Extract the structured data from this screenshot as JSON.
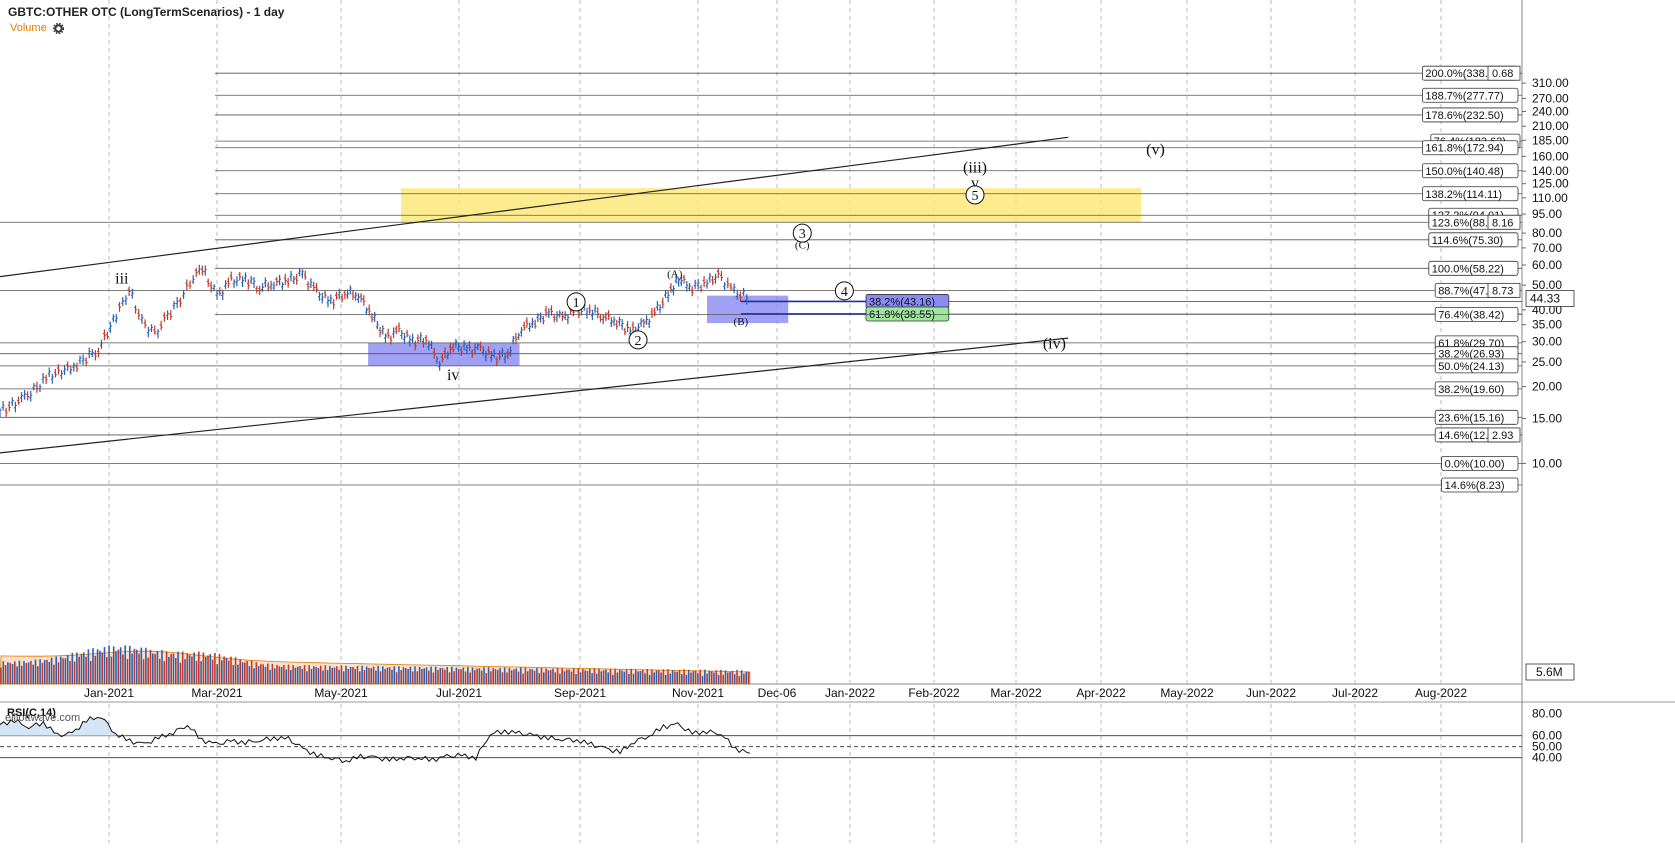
{
  "header": {
    "title": "GBTC:OTHER OTC (LongTermScenarios) - 1 day",
    "volume_label": "Volume",
    "watermark": "elliottwave.com"
  },
  "colors": {
    "up_bar": "#2962b5",
    "down_bar": "#c0392b",
    "yellow_zone": "#fde97a",
    "blue_zone": "#8080f0",
    "volume_ma_fill": "#f6c9a6",
    "rsi_fill": "#cfe3f5",
    "grid": "#bbbbbb"
  },
  "chart_data": [
    {
      "type": "line",
      "title": "GBTC:OTHER OTC (LongTermScenarios) - 1 day",
      "y_scale": "log",
      "ylim": [
        8,
        330
      ],
      "x_ticks": [
        "Jan-2021",
        "Mar-2021",
        "May-2021",
        "Jul-2021",
        "Sep-2021",
        "Nov-2021",
        "Dec-06",
        "Jan-2022",
        "Feb-2022",
        "Mar-2022",
        "Apr-2022",
        "May-2022",
        "Jun-2022",
        "Jul-2022",
        "Aug-2022"
      ],
      "y_ticks": [
        310.0,
        270.0,
        240.0,
        210.0,
        185.0,
        160.0,
        140.0,
        125.0,
        110.0,
        95.0,
        80.0,
        70.0,
        60.0,
        50.0,
        40.0,
        35.0,
        30.0,
        25.0,
        20.0,
        15.0,
        10.0
      ],
      "last_price": "44.33",
      "last_price_value": 44.33,
      "volume_last": "5.6M",
      "price_path": [
        [
          "2020-12-01",
          16
        ],
        [
          "2020-12-08",
          18
        ],
        [
          "2020-12-15",
          22
        ],
        [
          "2020-12-22",
          24
        ],
        [
          "2020-12-29",
          28
        ],
        [
          "2021-01-05",
          38
        ],
        [
          "2021-01-12",
          48
        ],
        [
          "2021-01-19",
          36
        ],
        [
          "2021-01-26",
          32
        ],
        [
          "2021-02-02",
          38
        ],
        [
          "2021-02-09",
          44
        ],
        [
          "2021-02-16",
          54
        ],
        [
          "2021-02-21",
          58
        ],
        [
          "2021-03-01",
          45
        ],
        [
          "2021-03-08",
          52
        ],
        [
          "2021-03-15",
          53
        ],
        [
          "2021-03-22",
          49
        ],
        [
          "2021-03-29",
          51
        ],
        [
          "2021-04-05",
          52
        ],
        [
          "2021-04-12",
          55
        ],
        [
          "2021-04-19",
          47
        ],
        [
          "2021-04-26",
          43
        ],
        [
          "2021-05-03",
          47
        ],
        [
          "2021-05-10",
          46
        ],
        [
          "2021-05-17",
          38
        ],
        [
          "2021-05-24",
          31
        ],
        [
          "2021-05-31",
          33
        ],
        [
          "2021-06-07",
          30
        ],
        [
          "2021-06-14",
          31
        ],
        [
          "2021-06-21",
          25
        ],
        [
          "2021-06-28",
          29
        ],
        [
          "2021-07-05",
          28
        ],
        [
          "2021-07-12",
          28
        ],
        [
          "2021-07-19",
          26
        ],
        [
          "2021-07-26",
          27
        ],
        [
          "2021-08-02",
          34
        ],
        [
          "2021-08-09",
          36
        ],
        [
          "2021-08-16",
          39
        ],
        [
          "2021-08-23",
          37
        ],
        [
          "2021-08-30",
          40
        ],
        [
          "2021-09-06",
          40
        ],
        [
          "2021-09-13",
          38
        ],
        [
          "2021-09-20",
          36
        ],
        [
          "2021-09-27",
          33
        ],
        [
          "2021-10-04",
          35
        ],
        [
          "2021-10-11",
          40
        ],
        [
          "2021-10-18",
          48
        ],
        [
          "2021-10-22",
          53
        ],
        [
          "2021-10-29",
          49
        ],
        [
          "2021-11-05",
          51
        ],
        [
          "2021-11-10",
          55
        ],
        [
          "2021-11-17",
          47
        ],
        [
          "2021-11-24",
          44.33
        ]
      ],
      "fib_levels": [
        {
          "label": "200.0%(338.96)",
          "value": 338.96
        },
        {
          "label": "188.7%(277.77)",
          "value": 277.77
        },
        {
          "label": "178.6%(232.50)",
          "value": 232.5
        },
        {
          "label": "76.4%(183.62)",
          "value": 183.62
        },
        {
          "label": "161.8%(172.94)",
          "value": 172.94
        },
        {
          "label": "150.0%(140.48)",
          "value": 140.48
        },
        {
          "label": "138.2%(114.11)",
          "value": 114.11
        },
        {
          "label": "127.2%(94.01)",
          "value": 94.01
        },
        {
          "label": "123.6%(88.23)",
          "value": 88.23
        },
        {
          "label": "114.6%(75.30)",
          "value": 75.3
        },
        {
          "label": "100.0%(58.22)",
          "value": 58.22
        },
        {
          "label": "88.7%(47.71)",
          "value": 47.71
        },
        {
          "label": "38.2%(43.16)",
          "value": 43.16
        },
        {
          "label": "61.8%(38.55)",
          "value": 38.55
        },
        {
          "label": "76.4%(38.42)",
          "value": 38.42
        },
        {
          "label": "61.8%(29.70)",
          "value": 29.7
        },
        {
          "label": "38.2%(26.93)",
          "value": 26.93
        },
        {
          "label": "50.0%(24.13)",
          "value": 24.13
        },
        {
          "label": "38.2%(19.60)",
          "value": 19.6
        },
        {
          "label": "23.6%(15.16)",
          "value": 15.16
        },
        {
          "label": "14.6%(12.93)",
          "value": 12.93
        },
        {
          "label": "0.0%(10.00)",
          "value": 10.0
        },
        {
          "label": "14.6%(8.23)",
          "value": 8.23
        }
      ],
      "right_axis_fragments": [
        "0.68",
        "8.16",
        "8.73",
        "2.93"
      ],
      "zones": [
        {
          "name": "yellow-target-zone",
          "date_from": "2021-06-01",
          "date_to": "2022-04-15",
          "y_from": 88.23,
          "y_to": 120
        },
        {
          "name": "wave-iv-support-zone",
          "date_from": "2021-05-15",
          "date_to": "2021-08-01",
          "y_from": 24.13,
          "y_to": 29.7
        },
        {
          "name": "wave-4-support-zone",
          "date_from": "2021-11-05",
          "date_to": "2021-12-10",
          "y_from": 35.5,
          "y_to": 45.5
        }
      ],
      "trendlines": [
        {
          "from": [
            "2020-12-01",
            54
          ],
          "to": [
            "2022-03-20",
            190
          ]
        },
        {
          "from": [
            "2020-12-01",
            11
          ],
          "to": [
            "2022-03-20",
            31
          ]
        }
      ],
      "wave_labels": [
        {
          "text": "iii",
          "date": "2021-01-08",
          "value": 53,
          "circled": false
        },
        {
          "text": "iv",
          "date": "2021-06-28",
          "value": 22.2,
          "circled": false
        },
        {
          "text": "1",
          "date": "2021-08-30",
          "value": 43,
          "circled": true
        },
        {
          "text": "2",
          "date": "2021-10-01",
          "value": 30.5,
          "circled": true
        },
        {
          "text": "(A)",
          "date": "2021-10-20",
          "value": 56,
          "circled": false
        },
        {
          "text": "(B)",
          "date": "2021-11-20",
          "value": 36.5,
          "circled": false
        },
        {
          "text": "3",
          "date": "2021-12-15",
          "value": 80,
          "circled": true
        },
        {
          "text": "(C)",
          "date": "2021-12-15",
          "value": 73,
          "circled": false
        },
        {
          "text": "4",
          "date": "2021-12-30",
          "value": 47.5,
          "circled": true
        },
        {
          "text": "(iii)",
          "date": "2022-02-15",
          "value": 145,
          "circled": false
        },
        {
          "text": "v",
          "date": "2022-02-15",
          "value": 126,
          "circled": false
        },
        {
          "text": "5",
          "date": "2022-02-15",
          "value": 113,
          "circled": true
        },
        {
          "text": "(iv)",
          "date": "2022-03-15",
          "value": 29.5,
          "circled": false
        },
        {
          "text": "(v)",
          "date": "2022-04-20",
          "value": 170,
          "circled": false
        }
      ]
    },
    {
      "type": "line",
      "title": "RSI(C,14)",
      "ylim": [
        35,
        85
      ],
      "y_ticks": [
        80.0,
        60.0,
        50.0,
        40.0
      ],
      "levels": [
        60,
        50,
        40
      ],
      "values": [
        70,
        74,
        68,
        72,
        60,
        62,
        74,
        78,
        62,
        55,
        52,
        58,
        63,
        70,
        56,
        52,
        55,
        54,
        56,
        58,
        57,
        48,
        42,
        40,
        37,
        41,
        40,
        38,
        40,
        40,
        38,
        41,
        42,
        40,
        62,
        64,
        62,
        60,
        58,
        57,
        56,
        52,
        48,
        45,
        55,
        60,
        68,
        70,
        62,
        64,
        62,
        48,
        44
      ]
    }
  ]
}
